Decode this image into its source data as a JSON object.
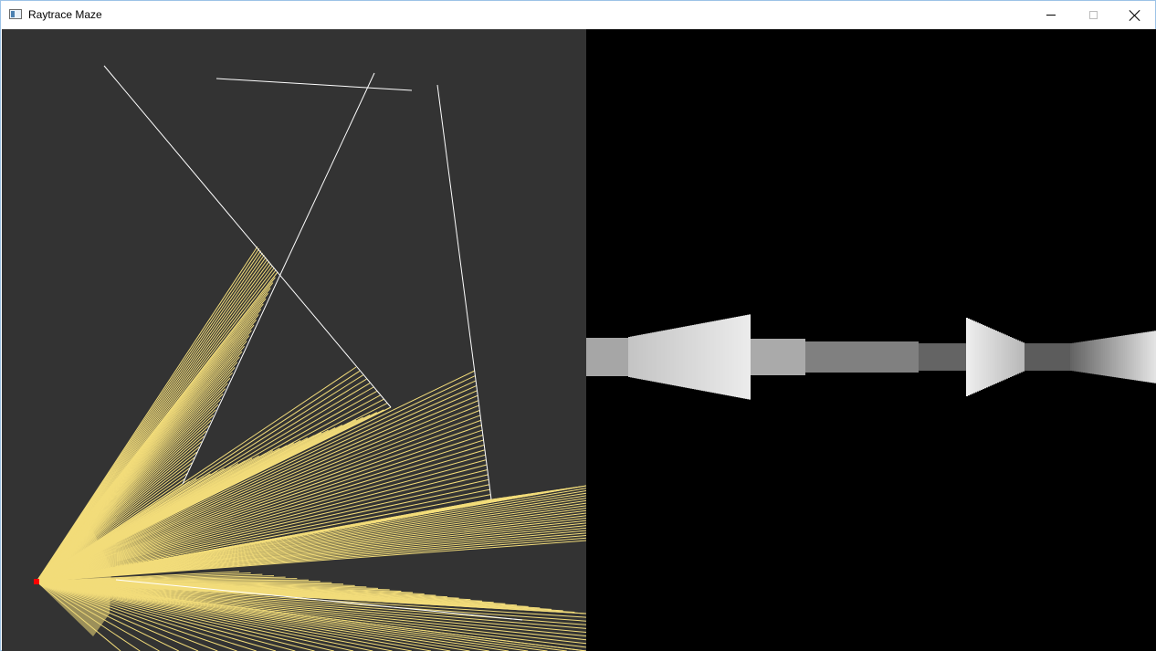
{
  "window": {
    "title": "Raytrace Maze",
    "controls": {
      "minimize": "minimize-icon",
      "maximize": "maximize-icon",
      "close": "close-icon"
    }
  },
  "colors": {
    "map_background": "#333333",
    "wall": "#ffffff",
    "ray": "#f2dc7a",
    "player": "#ff0000",
    "render_background": "#000000"
  }
}
